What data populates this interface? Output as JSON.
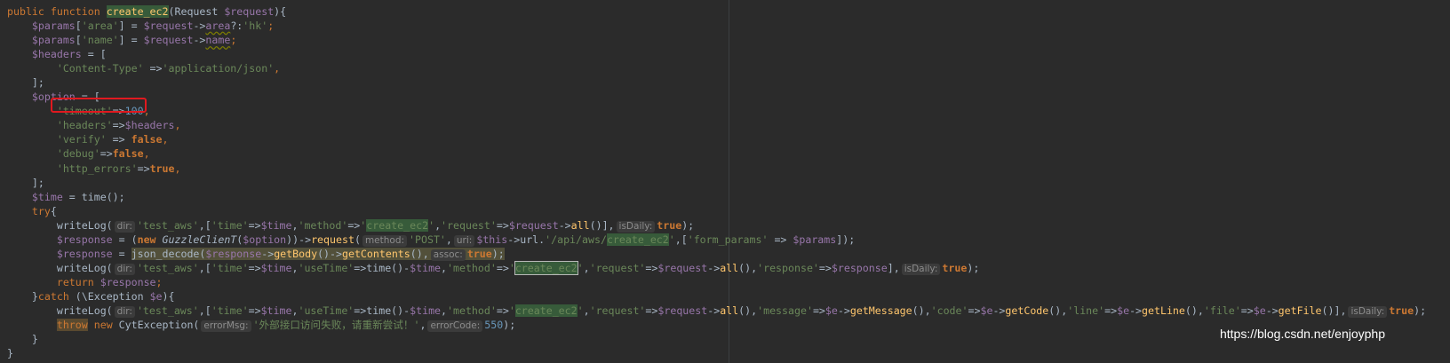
{
  "code": {
    "line1": {
      "kw": "public function ",
      "fname": "create_ec2",
      "sig": "(Request ",
      "param": "$request",
      "end": "){"
    },
    "line2": {
      "v": "$params",
      "s1": "'area'",
      "mid": "] = ",
      "v2": "$request",
      "arrow": "->",
      "prop": "area",
      "q": "?:",
      "s2": "'hk'",
      "end": ";"
    },
    "line3": {
      "v": "$params",
      "s1": "'name'",
      "mid": "] = ",
      "v2": "$request",
      "arrow": "->",
      "prop": "name",
      "end": ";"
    },
    "line4": {
      "v": "$headers",
      "rest": " = ["
    },
    "line5": {
      "s1": "'Content-Type'",
      "arrow": " =>",
      "s2": "'application/json'",
      "end": ","
    },
    "line6": {
      "text": "];"
    },
    "line7": {
      "v": "$option",
      "rest": " = ["
    },
    "line8": {
      "s1": "'timeout'",
      "arrow": "=>",
      "num": "100",
      "end": ","
    },
    "line9": {
      "s1": "'headers'",
      "arrow": "=>",
      "v": "$headers",
      "end": ","
    },
    "line10": {
      "s1": "'verify'",
      "arrow": " => ",
      "kw": "false",
      "end": ","
    },
    "line11": {
      "s1": "'debug'",
      "arrow": "=>",
      "kw": "false",
      "end": ","
    },
    "line12": {
      "s1": "'http_errors'",
      "arrow": "=>",
      "kw": "true",
      "end": ","
    },
    "line13": {
      "text": "];"
    },
    "line14": {
      "v": "$time",
      "rest": " = time();"
    },
    "line15": {
      "kw": "try",
      "rest": "{"
    },
    "line16": {
      "fn": "writeLog(",
      "hint1": "dir:",
      "s1": "'test_aws'",
      "p1": ",[",
      "s2": "'time'",
      "a1": "=>",
      "v1": "$time",
      "c1": ",",
      "s3": "'method'",
      "a2": "=>",
      "q1": "'",
      "hl": "create_ec2",
      "q2": "'",
      "c2": ",",
      "s4": "'request'",
      "a3": "=>",
      "v2": "$request",
      "arr": "->",
      "m": "all",
      "p2": "()],",
      "hint2": "isDaily:",
      "kw": "true",
      "end": ");"
    },
    "line17": {
      "v1": "$response",
      "eq": " = (",
      "kw": "new",
      "cls": " GuzzleClienT",
      "p1": "(",
      "v2": "$option",
      "p2": "))->",
      "m": "request",
      "p3": "(",
      "hint1": "method:",
      "s1": "'POST'",
      "c1": ",",
      "hint2": "uri:",
      "v3": "$this",
      "arr": "->url.",
      "s2": "'/api/aws/",
      "hl": "create_ec2",
      "s3": "'",
      "c2": ",[",
      "s4": "'form_params'",
      "a": " => ",
      "v4": "$params",
      "end": "]);"
    },
    "line18": {
      "v1": "$response",
      "eq": " = ",
      "fn": "json_decode(",
      "v2": "$response",
      "arr": "->",
      "m1": "getBody",
      "p1": "()->",
      "m2": "getContents",
      "p2": "(),",
      "hint": "assoc:",
      "kw": "true",
      "end": ");"
    },
    "line19": {
      "fn": "writeLog(",
      "hint1": "dir:",
      "s1": "'test_aws'",
      "p1": ",[",
      "s2": "'time'",
      "a1": "=>",
      "v1": "$time",
      "c1": ",",
      "s3": "'useTime'",
      "a2": "=>time()-",
      "v2": "$time",
      "c2": ",",
      "s4": "'method'",
      "a3": "=>",
      "q1": "'",
      "hl": "create_ec2",
      "q2": "'",
      "c3": ",",
      "s5": "'request'",
      "a4": "=>",
      "v3": "$request",
      "arr": "->",
      "m": "all",
      "p2": "(),",
      "s6": "'response'",
      "a5": "=>",
      "v4": "$response",
      "p3": "],",
      "hint2": "isDaily:",
      "kw": "true",
      "end": ");"
    },
    "line20": {
      "kw": "return",
      "sp": " ",
      "v": "$response",
      "end": ";"
    },
    "line21": {
      "b": "}",
      "kw": "catch",
      "p1": " (\\Exception ",
      "v": "$e",
      "end": "){"
    },
    "line22": {
      "fn": "writeLog(",
      "hint1": "dir:",
      "s1": "'test_aws'",
      "p1": ",[",
      "s2": "'time'",
      "a1": "=>",
      "v1": "$time",
      "c1": ",",
      "s3": "'useTime'",
      "a2": "=>time()-",
      "v2": "$time",
      "c2": ",",
      "s4": "'method'",
      "a3": "=>",
      "q1": "'",
      "hl": "create_ec2",
      "q2": "'",
      "c3": ",",
      "s5": "'request'",
      "a4": "=>",
      "v3": "$request",
      "arr1": "->",
      "m1": "all",
      "p2": "(),",
      "s6": "'message'",
      "a5": "=>",
      "v4": "$e",
      "arr2": "->",
      "m2": "getMessage",
      "p3": "(),",
      "s7": "'code'",
      "a6": "=>",
      "v5": "$e",
      "arr3": "->",
      "m3": "getCode",
      "p4": "(),",
      "s8": "'line'",
      "a7": "=>",
      "v6": "$e",
      "arr4": "->",
      "m4": "getLine",
      "p5": "(),",
      "s9": "'file'",
      "a8": "=>",
      "v7": "$e",
      "arr5": "->",
      "m5": "getFile",
      "p6": "()],",
      "hint2": "isDaily:",
      "kw": "true",
      "end": ");"
    },
    "line23": {
      "kw1": "throw",
      "sp": " ",
      "kw2": "new",
      "cls": " CytException(",
      "hint1": "errorMsg:",
      "s1": "'外部接口访问失败，请重新尝试！'",
      "c1": ",",
      "hint2": "errorCode:",
      "num": "550",
      "end": ");"
    },
    "line24": {
      "text": "}"
    },
    "line25": {
      "text": "}"
    }
  },
  "watermark": "https://blog.csdn.net/enjoyphp",
  "colors": {
    "background": "#2b2b2b",
    "keyword": "#cc7832",
    "function": "#ffc66d",
    "variable": "#9876aa",
    "string": "#6a8759",
    "number": "#6897bb",
    "annotation_box": "#e0191f"
  }
}
